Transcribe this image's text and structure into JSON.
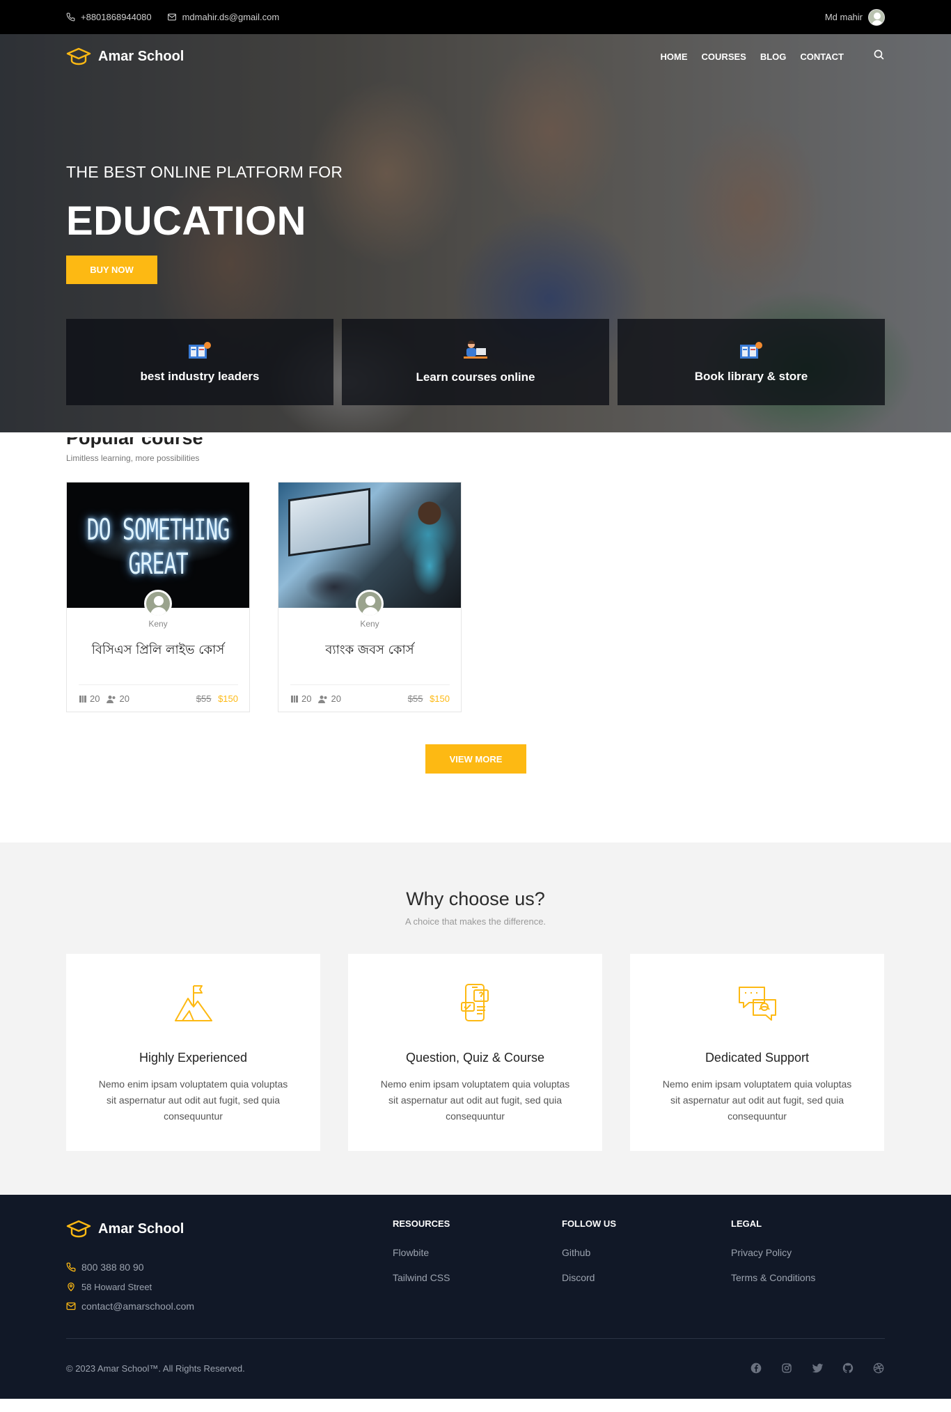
{
  "topbar": {
    "phone": "+8801868944080",
    "email": "mdmahir.ds@gmail.com",
    "user_name": "Md mahir"
  },
  "brand": {
    "name": "Amar School"
  },
  "nav": {
    "items": [
      {
        "label": "HOME"
      },
      {
        "label": "COURSES"
      },
      {
        "label": "BLOG"
      },
      {
        "label": "CONTACT"
      }
    ]
  },
  "hero": {
    "subtitle": "THE BEST ONLINE PLATFORM FOR",
    "title": "EDUCATION",
    "button_label": "BUY NOW",
    "features": [
      {
        "label": "best industry leaders"
      },
      {
        "label": "Learn courses online"
      },
      {
        "label": "Book library & store"
      }
    ]
  },
  "popular": {
    "title": "Popular course",
    "subtitle": "Limitless learning, more possibilities",
    "courses": [
      {
        "thumb_text": "DO SOMETHING GREAT",
        "author": "Keny",
        "title": "বিসিএস প্রিলি লাইভ কোর্স",
        "lessons": "20",
        "students": "20",
        "old_price": "$55",
        "price": "$150"
      },
      {
        "author": "Keny",
        "title": "ব্যাংক জবস কোর্স",
        "lessons": "20",
        "students": "20",
        "old_price": "$55",
        "price": "$150"
      }
    ],
    "view_more_label": "VIEW MORE"
  },
  "why": {
    "title": "Why choose us?",
    "subtitle": "A choice that makes the difference.",
    "cards": [
      {
        "icon": "mountain-flag-icon",
        "title": "Highly Experienced",
        "text": "Nemo enim ipsam voluptatem quia voluptas sit aspernatur aut odit aut fugit, sed quia consequuntur"
      },
      {
        "icon": "mobile-quiz-icon",
        "title": "Question, Quiz & Course",
        "text": "Nemo enim ipsam voluptatem quia voluptas sit aspernatur aut odit aut fugit, sed quia consequuntur"
      },
      {
        "icon": "chat-support-icon",
        "title": "Dedicated Support",
        "text": "Nemo enim ipsam voluptatem quia voluptas sit aspernatur aut odit aut fugit, sed quia consequuntur"
      }
    ]
  },
  "footer": {
    "brand": "Amar School",
    "phone": "800 388 80 90",
    "address": "58 Howard Street",
    "email": "contact@amarschool.com",
    "columns": [
      {
        "title": "RESOURCES",
        "links": [
          "Flowbite",
          "Tailwind CSS"
        ]
      },
      {
        "title": "FOLLOW US",
        "links": [
          "Github",
          "Discord"
        ]
      },
      {
        "title": "LEGAL",
        "links": [
          "Privacy Policy",
          "Terms & Conditions"
        ]
      }
    ],
    "copyright": "© 2023  Amar School™. All Rights Reserved.",
    "socials": [
      "facebook-icon",
      "instagram-icon",
      "twitter-icon",
      "github-icon",
      "dribbble-icon"
    ]
  },
  "colors": {
    "accent": "#fdb913",
    "topbar_bg": "#000000",
    "footer_bg": "#111827",
    "section_bg": "#f3f3f3"
  }
}
